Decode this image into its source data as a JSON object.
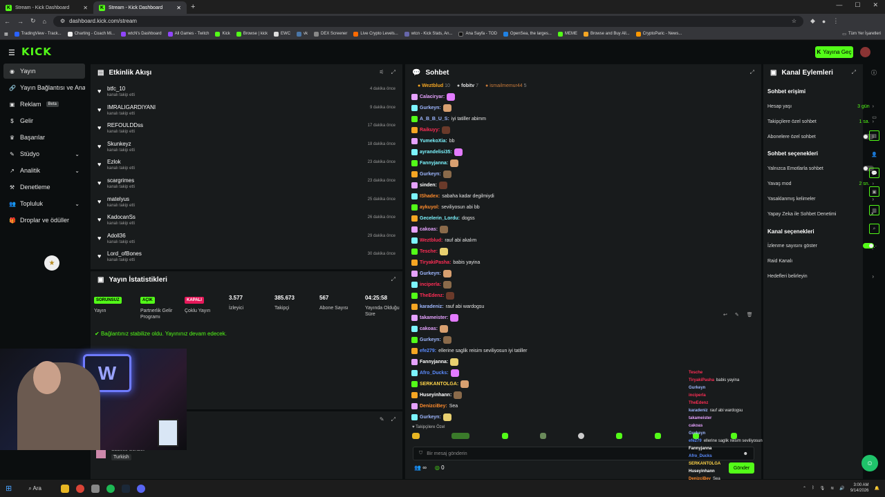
{
  "browser": {
    "tabs": [
      {
        "label": "Stream - Kick Dashboard"
      },
      {
        "label": "Stream - Kick Dashboard"
      }
    ],
    "url": "dashboard.kick.com/stream",
    "bookmarks": [
      "TradingView - Track...",
      "Charting - Coach Mi...",
      "wtcN's Dashboard",
      "All Games - Twitch",
      "Kick",
      "Browse | kick",
      "EWC",
      "vk",
      "DEX Screener",
      "Live Crypto Levels...",
      "wtcn - Kick Stats, An...",
      "Ana Sayfa - TOD",
      "OpenSea, the larges...",
      "MEME",
      "Browse and Buy All...",
      "CryptoParic - News..."
    ],
    "all_bookmarks": "Tüm Yer İşaretleri"
  },
  "app": {
    "logo": "KICK",
    "go_live": "Yayına Geç"
  },
  "sidebar": {
    "items": [
      {
        "label": "Yayın"
      },
      {
        "label": "Yayın Bağlantısı ve Anahtarı"
      },
      {
        "label": "Reklam",
        "badge": "Beta"
      },
      {
        "label": "Gelir"
      },
      {
        "label": "Başarılar"
      },
      {
        "label": "Stüdyo"
      },
      {
        "label": "Analitik"
      },
      {
        "label": "Denetleme"
      },
      {
        "label": "Topluluk"
      },
      {
        "label": "Droplar ve ödüller"
      }
    ]
  },
  "activity": {
    "title": "Etkinlik Akışı",
    "items": [
      {
        "name": "btfc_10",
        "sub": "kanalı takip etti",
        "time": "4 dakika önce"
      },
      {
        "name": "IMRALIGARDIYANI",
        "sub": "kanalı takip etti",
        "time": "9 dakika önce"
      },
      {
        "name": "REFOULDDss",
        "sub": "kanalı takip etti",
        "time": "17 dakika önce"
      },
      {
        "name": "Skunkeyz",
        "sub": "kanalı takip etti",
        "time": "18 dakika önce"
      },
      {
        "name": "Ezlok",
        "sub": "kanalı takip etti",
        "time": "23 dakika önce"
      },
      {
        "name": "scargrimes",
        "sub": "kanalı takip etti",
        "time": "23 dakika önce"
      },
      {
        "name": "matelyus",
        "sub": "kanalı takip etti",
        "time": "25 dakika önce"
      },
      {
        "name": "KadocanSs",
        "sub": "kanalı takip etti",
        "time": "26 dakika önce"
      },
      {
        "name": "Adoll36",
        "sub": "kanalı takip etti",
        "time": "29 dakika önce"
      },
      {
        "name": "Lord_ofBones",
        "sub": "kanalı takip etti",
        "time": "30 dakika önce"
      }
    ]
  },
  "stats": {
    "title": "Yayın İstatistikleri",
    "cols": [
      {
        "badge": "SORUNSUZ",
        "badge_color": "#53fc18",
        "label": "Yayın"
      },
      {
        "badge": "AÇIK",
        "badge_color": "#53fc18",
        "label": "Partnerlik Gelir Programı"
      },
      {
        "badge": "KAPALI",
        "badge_color": "#e6185a",
        "label": "Çoklu Yayın"
      },
      {
        "value": "3.577",
        "label": "İzleyici"
      },
      {
        "value": "385.673",
        "label": "Takipçi"
      },
      {
        "value": "567",
        "label": "Abone Sayısı"
      },
      {
        "value": "04:25:58",
        "label": "Yayında Olduğu Süre"
      }
    ],
    "message": "Bağlantınız stabilize oldu. Yayınınız devam edecek."
  },
  "lower_panel": {
    "line1": "Sadece Sohbet",
    "tag": "Turkish"
  },
  "chat": {
    "title": "Sohbet",
    "pinned": [
      {
        "name": "Weztblud",
        "n": "10"
      },
      {
        "name": "fobitv",
        "n": "7"
      },
      {
        "name": "ismailmemur44",
        "n": "5"
      }
    ],
    "messages": [
      {
        "user": "Calaciryar:",
        "color": "#e6a2ff",
        "text": ""
      },
      {
        "user": "Gurkeyn:",
        "color": "#9fb8ff",
        "text": ""
      },
      {
        "user": "A_B_B_U_S:",
        "color": "#9fb8ff",
        "text": "iyi tatiller abimm"
      },
      {
        "user": "Raikuyy:",
        "color": "#ff2d55",
        "text": ""
      },
      {
        "user": "YumekoXia:",
        "color": "#7cf5ff",
        "text": "bb"
      },
      {
        "user": "ayrandelisi35:",
        "color": "#7cf5ff",
        "text": ""
      },
      {
        "user": "Fannyjanna:",
        "color": "#7cf5ff",
        "text": ""
      },
      {
        "user": "Gurkeyn:",
        "color": "#9fb8ff",
        "text": ""
      },
      {
        "user": "sinden:",
        "color": "#ffffff",
        "text": ""
      },
      {
        "user": "IShadex:",
        "color": "#ff8c2d",
        "text": "sabaha kadar degilmiydi"
      },
      {
        "user": "aykuyol:",
        "color": "#ff8c2d",
        "text": "seviliyosun abi bb"
      },
      {
        "user": "Gecelerin_Lordu:",
        "color": "#7cf5ff",
        "text": "dogss"
      },
      {
        "user": "cakoas:",
        "color": "#e6a2ff",
        "text": ""
      },
      {
        "user": "Weztblud:",
        "color": "#ff2d55",
        "text": "rauf abi akalım"
      },
      {
        "user": "Tesche:",
        "color": "#ff2d55",
        "text": ""
      },
      {
        "user": "TiryakiPasha:",
        "color": "#ff2d55",
        "text": "babis yayina"
      },
      {
        "user": "Gurkeyn:",
        "color": "#9fb8ff",
        "text": ""
      },
      {
        "user": "inciperla:",
        "color": "#ff2d55",
        "text": ""
      },
      {
        "user": "TheEdenz:",
        "color": "#ff2d55",
        "text": ""
      },
      {
        "user": "karadeniz:",
        "color": "#9fb8ff",
        "text": "rauf abi wardogsu"
      },
      {
        "user": "takameister:",
        "color": "#e6a2ff",
        "text": ""
      },
      {
        "user": "cakoas:",
        "color": "#e6a2ff",
        "text": ""
      },
      {
        "user": "Gurkeyn:",
        "color": "#9fb8ff",
        "text": ""
      },
      {
        "user": "efe279:",
        "color": "#5b8cff",
        "text": "ellerine saglik reisim seviliyosun iyi tatiller"
      },
      {
        "user": "Fannyjanna:",
        "color": "#ffffff",
        "text": ""
      },
      {
        "user": "Afro_Ducks:",
        "color": "#5b8cff",
        "text": ""
      },
      {
        "user": "SERKANTOLGA:",
        "color": "#ffd54a",
        "text": ""
      },
      {
        "user": "Huseyinhann:",
        "color": "#ffffff",
        "text": ""
      },
      {
        "user": "DenizciBey:",
        "color": "#ff8c2d",
        "text": "Sea"
      },
      {
        "user": "Gurkeyn:",
        "color": "#9fb8ff",
        "text": ""
      }
    ],
    "followers_only": "Takipçilere Özel",
    "placeholder": "Bir mesaj gönderin",
    "send": "Gönder",
    "count_left": "∞",
    "count_right": "0"
  },
  "overlay": [
    {
      "user": "Tesche",
      "color": "#ff2d55",
      "text": ""
    },
    {
      "user": "TiryakiPasha",
      "color": "#ff2d55",
      "text": "babis yayina"
    },
    {
      "user": "Gurkeyn",
      "color": "#9fb8ff",
      "text": ""
    },
    {
      "user": "inciperla",
      "color": "#ff2d55",
      "text": ""
    },
    {
      "user": "TheEdenz",
      "color": "#ff2d55",
      "text": ""
    },
    {
      "user": "karadeniz",
      "color": "#9fb8ff",
      "text": "rauf abi wardogsu"
    },
    {
      "user": "takameister",
      "color": "#e6a2ff",
      "text": ""
    },
    {
      "user": "cakoas",
      "color": "#e6a2ff",
      "text": ""
    },
    {
      "user": "Gurkeyn",
      "color": "#9fb8ff",
      "text": ""
    },
    {
      "user": "efe279",
      "color": "#5b8cff",
      "text": "ellerine saglik reisim seviliyosun iyi tatiller"
    },
    {
      "user": "Fannyjanna",
      "color": "#ffffff",
      "text": ""
    },
    {
      "user": "Afro_Ducks",
      "color": "#5b8cff",
      "text": ""
    },
    {
      "user": "SERKANTOLGA",
      "color": "#ffd54a",
      "text": ""
    },
    {
      "user": "Huseyinhann",
      "color": "#ffffff",
      "text": ""
    },
    {
      "user": "DenizciBey",
      "color": "#ff8c2d",
      "text": "Sea"
    },
    {
      "user": "Gurkeyn",
      "color": "#9fb8ff",
      "text": ""
    }
  ],
  "channel": {
    "title": "Kanal Eylemleri",
    "chat_access": "Sohbet erişimi",
    "account_age": "Hesap yaşı",
    "account_age_val": "3 gün",
    "followers_only": "Takipçilere özel sohbet",
    "followers_only_val": "1 sa.",
    "subs_only": "Abonelere özel sohbet",
    "chat_options": "Sohbet seçenekleri",
    "emotes_only": "Yalnızca Emotlarla sohbet",
    "slow": "Yavaş mod",
    "slow_val": "2 sn.",
    "banned_words": "Yasaklanmış kelimeler",
    "ai_mod": "Yapay Zeka ile Sohbet Denetimi",
    "channel_options": "Kanal seçenekleri",
    "show_viewers": "İzlenme sayısını göster",
    "raid": "Raid Kanalı",
    "goals": "Hedefleri belirleyin"
  },
  "taskbar": {
    "search": "Ara",
    "time": "3:00 AM",
    "date": "9/14/2026"
  }
}
